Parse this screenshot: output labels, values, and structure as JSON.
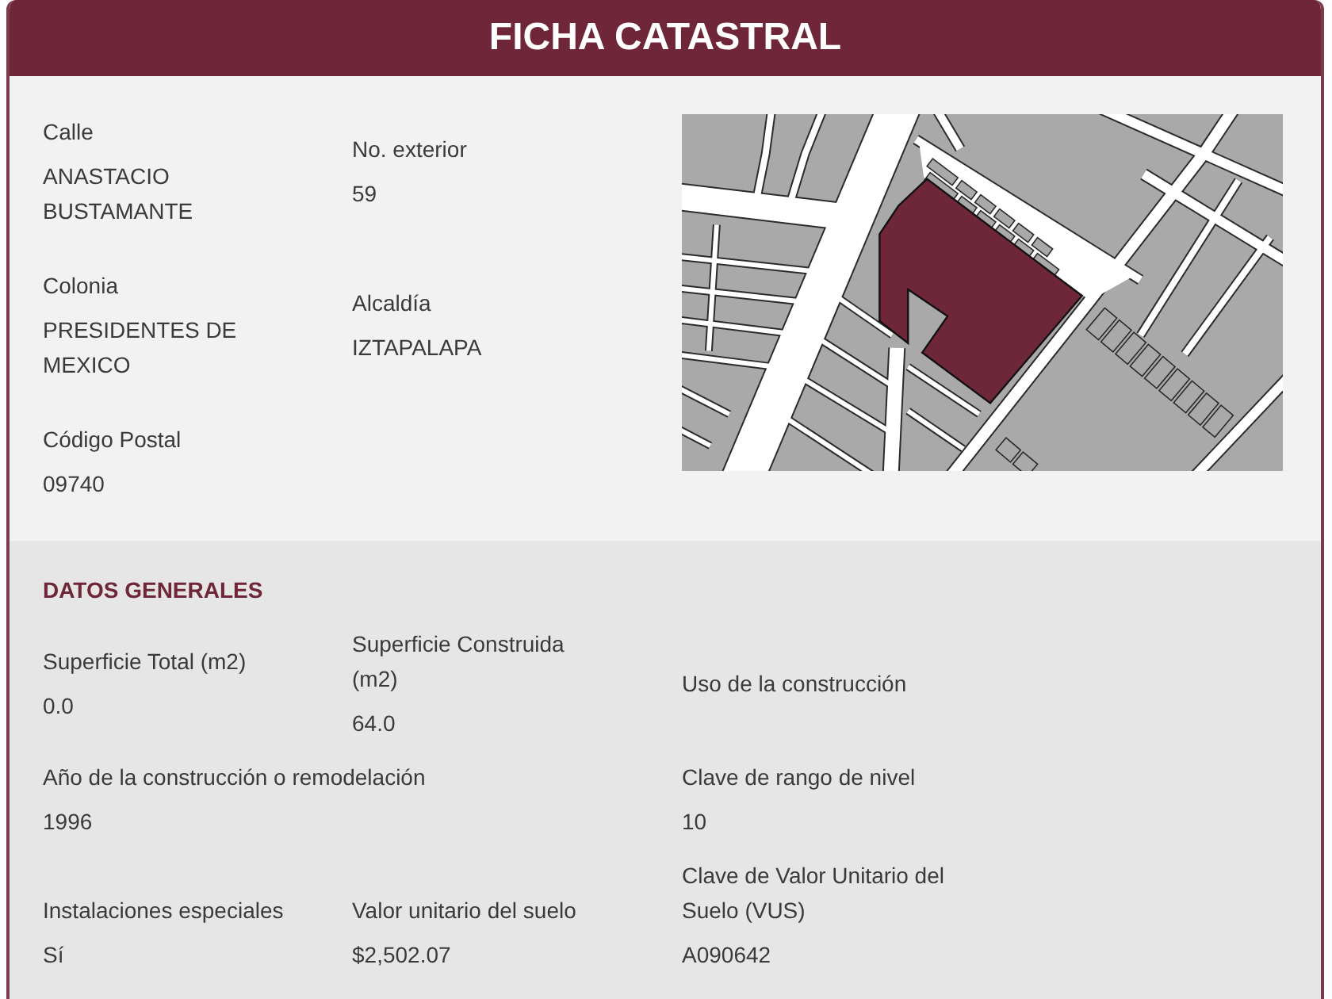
{
  "header": {
    "title": "FICHA CATASTRAL"
  },
  "address": {
    "fields": [
      {
        "label": "Calle",
        "value": "ANASTACIO BUSTAMANTE"
      },
      {
        "label": "No. exterior",
        "value": "59"
      },
      {
        "label": "Colonia",
        "value": "PRESIDENTES DE MEXICO"
      },
      {
        "label": "Alcaldía",
        "value": "IZTAPALAPA"
      },
      {
        "label": "Código Postal",
        "value": "09740"
      }
    ]
  },
  "general": {
    "title": "DATOS GENERALES",
    "rows": [
      [
        {
          "label": "Superficie Total (m2)",
          "value": "0.0"
        },
        {
          "label": "Superficie Construida (m2)",
          "value": "64.0"
        },
        {
          "label": "Uso de la construcción"
        }
      ],
      [
        {
          "label": "Año de la construcción o remodelación",
          "value": "1996",
          "colspan": 2
        },
        {
          "label": "Clave de rango de nivel",
          "value": "10"
        }
      ],
      [
        {
          "label": "Instalaciones especiales",
          "value": "Sí"
        },
        {
          "label": "Valor unitario del suelo",
          "value": "$2,502.07"
        },
        {
          "label": "Clave de Valor Unitario del Suelo (VUS)",
          "value": "A090642"
        }
      ]
    ]
  }
}
